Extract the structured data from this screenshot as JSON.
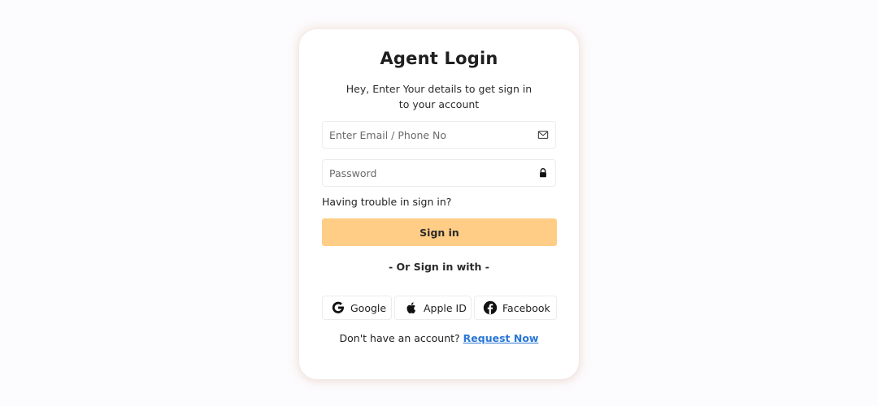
{
  "login": {
    "title": "Agent Login",
    "subtitle_line1": "Hey, Enter Your details to get sign in",
    "subtitle_line2": "to your account",
    "email_placeholder": "Enter Email / Phone No",
    "email_value": "",
    "email_icon": "envelope-icon",
    "password_placeholder": "Password",
    "password_value": "",
    "password_icon": "lock-icon",
    "trouble_text": "Having trouble in sign in?",
    "signin_label": "Sign in",
    "divider_text": "- Or Sign in with -",
    "social": [
      {
        "label": "Google",
        "icon": "google-icon"
      },
      {
        "label": "Apple ID",
        "icon": "apple-icon"
      },
      {
        "label": "Facebook",
        "icon": "facebook-icon"
      }
    ],
    "footer_text": "Don't have an account?",
    "footer_link": "Request Now"
  },
  "colors": {
    "primary_button": "#ffcd86",
    "link": "#2a77d6",
    "background": "#fcfbfd",
    "card": "#ffffff"
  }
}
